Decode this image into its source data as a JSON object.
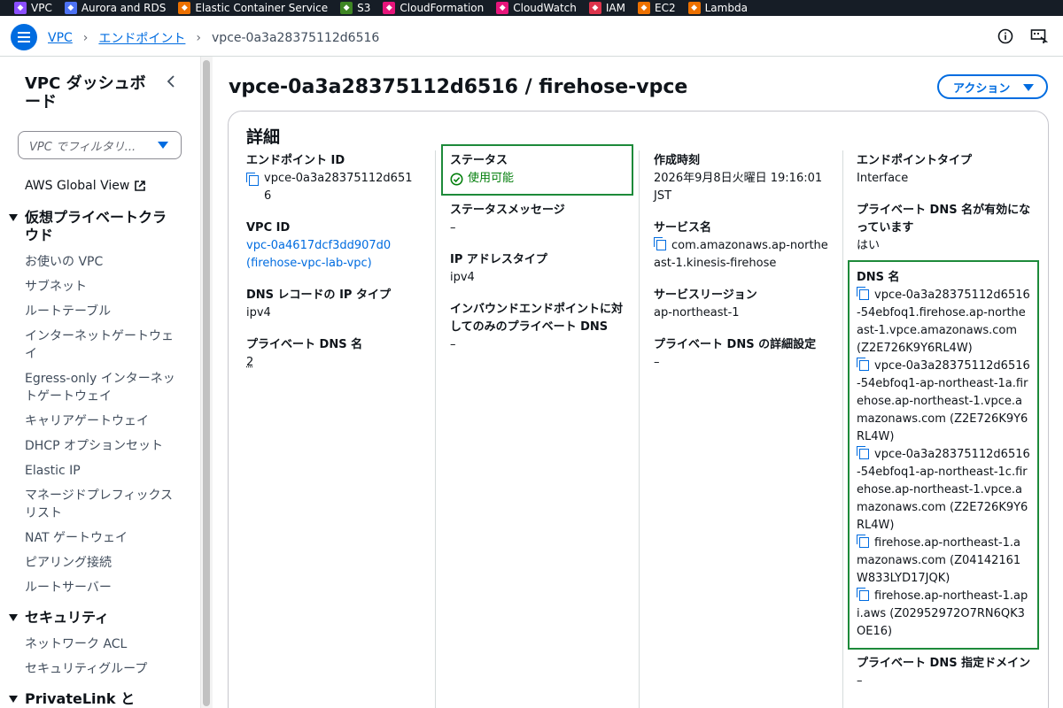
{
  "services": [
    {
      "label": "VPC",
      "icon": "vpc-icon",
      "color": "#8c4fff"
    },
    {
      "label": "Aurora and RDS",
      "icon": "rds-icon",
      "color": "#4d72f3"
    },
    {
      "label": "Elastic Container Service",
      "icon": "ecs-icon",
      "color": "#ed7100"
    },
    {
      "label": "S3",
      "icon": "s3-icon",
      "color": "#3f8624"
    },
    {
      "label": "CloudFormation",
      "icon": "cloudformation-icon",
      "color": "#e7157b"
    },
    {
      "label": "CloudWatch",
      "icon": "cloudwatch-icon",
      "color": "#e7157b"
    },
    {
      "label": "IAM",
      "icon": "iam-icon",
      "color": "#dd344c"
    },
    {
      "label": "EC2",
      "icon": "ec2-icon",
      "color": "#ed7100"
    },
    {
      "label": "Lambda",
      "icon": "lambda-icon",
      "color": "#ed7100"
    }
  ],
  "breadcrumb": {
    "root": "VPC",
    "parent": "エンドポイント",
    "current": "vpce-0a3a28375112d6516"
  },
  "sidebar": {
    "title": "VPC ダッシュボード",
    "filter_placeholder": "VPC でフィルタリ...",
    "global_view": "AWS Global View",
    "sections": [
      {
        "label": "仮想プライベートクラウド",
        "items": [
          "お使いの VPC",
          "サブネット",
          "ルートテーブル",
          "インターネットゲートウェイ",
          "Egress-only インターネットゲートウェイ",
          "キャリアゲートウェイ",
          "DHCP オプションセット",
          "Elastic IP",
          "マネージドプレフィックスリスト",
          "NAT ゲートウェイ",
          "ピアリング接続",
          "ルートサーバー"
        ]
      },
      {
        "label": "セキュリティ",
        "items": [
          "ネットワーク ACL",
          "セキュリティグループ"
        ]
      },
      {
        "label": "PrivateLink と Lattice",
        "items": []
      }
    ]
  },
  "page": {
    "title": "vpce-0a3a28375112d6516 / firehose-vpce",
    "action_label": "アクション"
  },
  "details": {
    "title": "詳細",
    "endpoint_id_label": "エンドポイント ID",
    "endpoint_id": "vpce-0a3a28375112d6516",
    "vpc_id_label": "VPC ID",
    "vpc_id": "vpc-0a4617dcf3dd907d0 (firehose-vpc-lab-vpc)",
    "dns_record_ip_type_label": "DNS レコードの IP タイプ",
    "dns_record_ip_type": "ipv4",
    "private_dns_name_label": "プライベート DNS 名",
    "private_dns_name": "2",
    "status_label": "ステータス",
    "status": "使用可能",
    "status_message_label": "ステータスメッセージ",
    "status_message": "–",
    "ip_address_type_label": "IP アドレスタイプ",
    "ip_address_type": "ipv4",
    "inbound_dns_label": "インバウンドエンドポイントに対してのみのプライベート DNS",
    "inbound_dns": "–",
    "created_label": "作成時刻",
    "created": "2026年9月8日火曜日 19:16:01 JST",
    "service_name_label": "サービス名",
    "service_name": "com.amazonaws.ap-northeast-1.kinesis-firehose",
    "service_region_label": "サービスリージョン",
    "service_region": "ap-northeast-1",
    "private_dns_detail_label": "プライベート DNS の詳細設定",
    "private_dns_detail": "–",
    "endpoint_type_label": "エンドポイントタイプ",
    "endpoint_type": "Interface",
    "private_dns_enabled_label": "プライベート DNS 名が有効になっています",
    "private_dns_enabled": "はい",
    "dns_names_label": "DNS 名",
    "dns_names": [
      "vpce-0a3a28375112d6516-54ebfoq1.firehose.ap-northeast-1.vpce.amazonaws.com (Z2E726K9Y6RL4W)",
      "vpce-0a3a28375112d6516-54ebfoq1-ap-northeast-1a.firehose.ap-northeast-1.vpce.amazonaws.com (Z2E726K9Y6RL4W)",
      "vpce-0a3a28375112d6516-54ebfoq1-ap-northeast-1c.firehose.ap-northeast-1.vpce.amazonaws.com (Z2E726K9Y6RL4W)",
      "firehose.ap-northeast-1.amazonaws.com (Z04142161W833LYD17JQK)",
      "firehose.ap-northeast-1.api.aws (Z02952972O7RN6QK3OE16)"
    ],
    "private_dns_domain_label": "プライベート DNS 指定ドメイン",
    "private_dns_domain": "–"
  }
}
